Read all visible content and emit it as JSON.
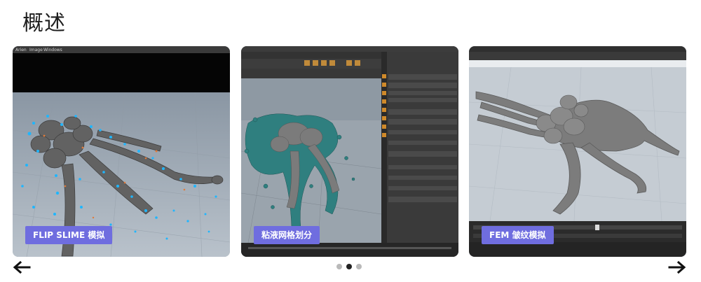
{
  "page": {
    "heading": "概述"
  },
  "slides": [
    {
      "badge": "FLIP SLIME 模拟",
      "menu": [
        "Arien",
        "Image",
        "Windows"
      ]
    },
    {
      "badge": "粘液网格划分"
    },
    {
      "badge": "FEM 皱纹模拟"
    }
  ],
  "carousel": {
    "prev_icon": "arrow-left-icon",
    "next_icon": "arrow-right-icon",
    "dot_count": 3,
    "active_index": 1
  },
  "colors": {
    "badge": "#6f6ddf",
    "particles": "#1fb6ff",
    "dot_active": "#222222",
    "dot_inactive": "#b9b9b9"
  }
}
